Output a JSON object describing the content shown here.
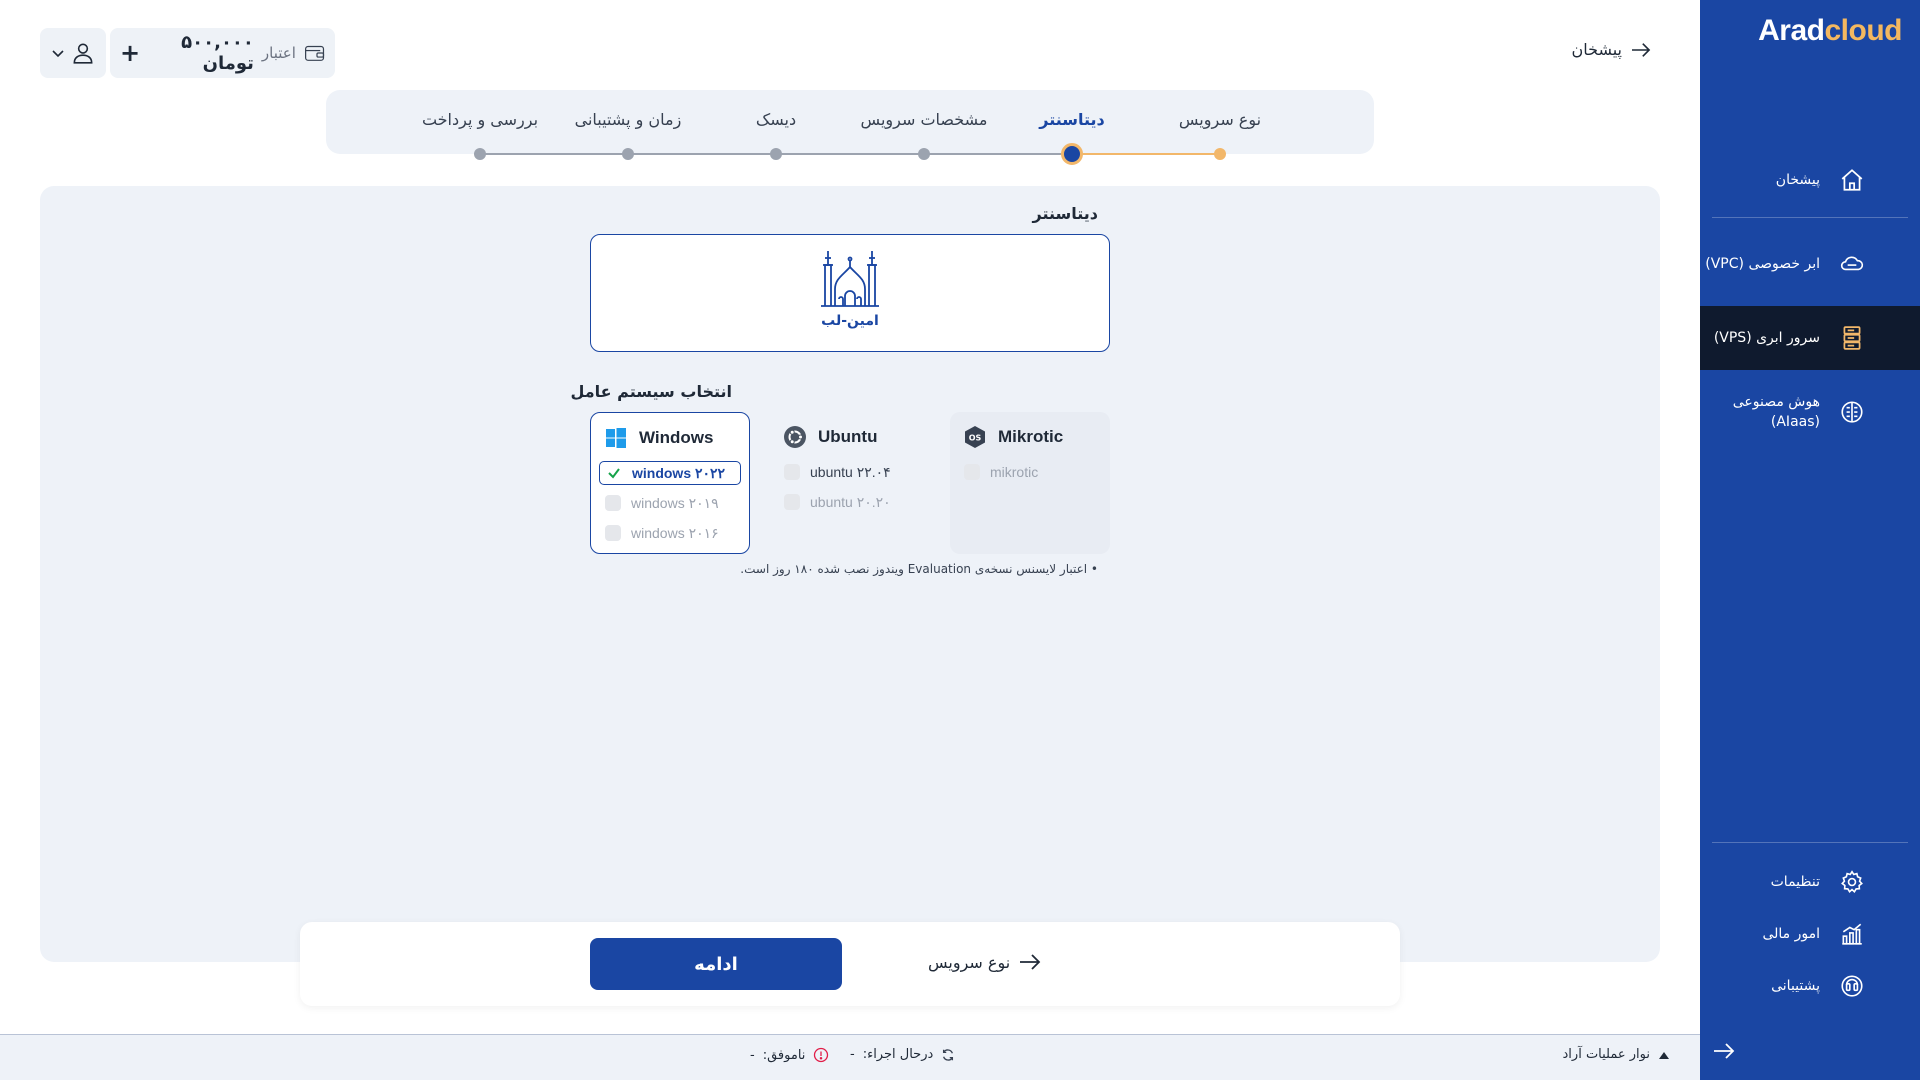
{
  "brand": {
    "logo_part1": "Arad",
    "logo_part2": "cloud",
    "color": "#1a46a3",
    "accent": "#f2b76a"
  },
  "header": {
    "back_label": "پیشخان",
    "credit_label": "اعتبار",
    "credit_amount": "۵۰۰,۰۰۰ تومان"
  },
  "sidebar": {
    "items": [
      {
        "label": "پیشخان",
        "icon": "home-icon"
      },
      {
        "label": "ابر خصوصی (VPC)",
        "icon": "cloud-icon"
      },
      {
        "label": "سرور ابری (VPS)",
        "icon": "server-icon",
        "active": true
      },
      {
        "label": "هوش مصنوعی (AIaas)",
        "icon": "ai-brain-icon"
      }
    ],
    "bottom": [
      {
        "label": "تنظیمات",
        "icon": "gear-icon"
      },
      {
        "label": "امور مالی",
        "icon": "finance-chart-icon"
      },
      {
        "label": "پشتیبانی",
        "icon": "support-icon"
      }
    ]
  },
  "stepper": {
    "steps": [
      {
        "label": "نوع سرویس",
        "state": "done"
      },
      {
        "label": "دیتاسنتر",
        "state": "active"
      },
      {
        "label": "مشخصات سرویس",
        "state": "todo"
      },
      {
        "label": "دیسک",
        "state": "todo"
      },
      {
        "label": "زمان و پشتیبانی",
        "state": "todo"
      },
      {
        "label": "بررسی و پرداخت",
        "state": "todo"
      }
    ]
  },
  "datacenter": {
    "title": "دیتاسنتر",
    "selected_name": "امین-لب"
  },
  "os": {
    "title": "انتخاب سیستم عامل",
    "groups": [
      {
        "name": "Windows",
        "icon": "windows-icon",
        "versions": [
          "windows ۲۰۲۲",
          "windows ۲۰۱۹",
          "windows ۲۰۱۶"
        ],
        "selected": "windows ۲۰۲۲"
      },
      {
        "name": "Ubuntu",
        "icon": "ubuntu-icon",
        "versions": [
          "ubuntu ۲۲.۰۴",
          "ubuntu ۲۰.۲۰"
        ]
      },
      {
        "name": "Mikrotic",
        "icon": "os-badge-icon",
        "versions": [
          "mikrotic"
        ]
      }
    ],
    "note": "• اعتبار لایسنس نسخه‌ی Evaluation ویندوز نصب شده ۱۸۰ روز است."
  },
  "footer": {
    "continue_label": "ادامه",
    "prev_label": "نوع سرویس"
  },
  "ops": {
    "toggle_label": "نوار عملیات آراد",
    "running_label": "درحال اجراء:",
    "running_value": "-",
    "failed_label": "ناموفق:",
    "failed_value": "-"
  }
}
